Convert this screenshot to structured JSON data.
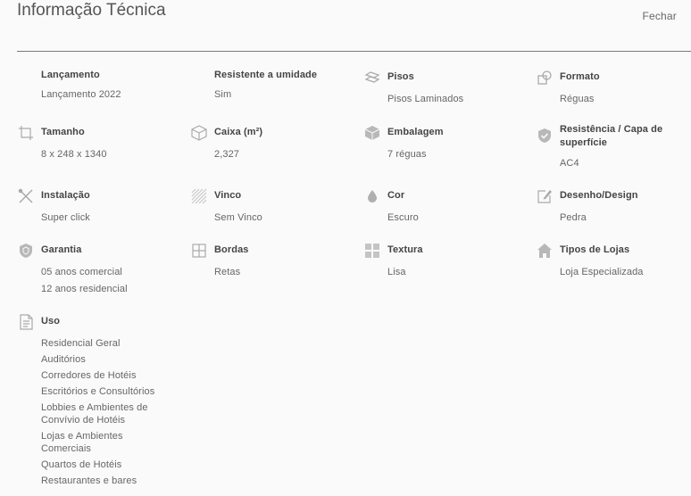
{
  "header": {
    "title": "Informação Técnica",
    "close_label": "Fechar"
  },
  "specs": {
    "lancamento": {
      "label": "Lançamento",
      "values": [
        "Lançamento 2022"
      ]
    },
    "umidade": {
      "label": "Resistente a umidade",
      "values": [
        "Sim"
      ]
    },
    "pisos": {
      "label": "Pisos",
      "icon": "floor-icon",
      "values": [
        "Pisos Laminados"
      ]
    },
    "formato": {
      "label": "Formato",
      "icon": "shapes-icon",
      "values": [
        "Réguas"
      ]
    },
    "tamanho": {
      "label": "Tamanho",
      "icon": "crop-icon",
      "values": [
        "8 x 248 x 1340"
      ]
    },
    "caixa": {
      "label": "Caixa (m²)",
      "icon": "box-icon",
      "values": [
        "2,327"
      ]
    },
    "embalagem": {
      "label": "Embalagem",
      "icon": "package-icon",
      "values": [
        "7 réguas"
      ]
    },
    "resistencia": {
      "label": "Resistência / Capa de superfície",
      "icon": "shield-check-icon",
      "values": [
        "AC4"
      ]
    },
    "instalacao": {
      "label": "Instalação",
      "icon": "tools-icon",
      "values": [
        "Super click"
      ]
    },
    "vinco": {
      "label": "Vinco",
      "icon": "hatch-icon",
      "values": [
        "Sem Vinco"
      ]
    },
    "cor": {
      "label": "Cor",
      "icon": "drop-icon",
      "values": [
        "Escuro"
      ]
    },
    "design": {
      "label": "Desenho/Design",
      "icon": "pencil-icon",
      "values": [
        "Pedra"
      ]
    },
    "garantia": {
      "label": "Garantia",
      "icon": "shield-icon",
      "values": [
        "05 anos comercial",
        "12 anos residencial"
      ]
    },
    "bordas": {
      "label": "Bordas",
      "icon": "grid-icon",
      "values": [
        "Retas"
      ]
    },
    "textura": {
      "label": "Textura",
      "icon": "texture-icon",
      "values": [
        "Lisa"
      ]
    },
    "lojas": {
      "label": "Tipos de Lojas",
      "icon": "store-icon",
      "values": [
        "Loja Especializada"
      ]
    },
    "uso": {
      "label": "Uso",
      "icon": "document-icon",
      "values": [
        "Residencial Geral",
        "Auditórios",
        "Corredores de Hotéis",
        "Escritórios e Consultórios",
        "Lobbies e Ambientes de Convívio de Hotéis",
        "Lojas e Ambientes Comerciais",
        "Quartos de Hotéis",
        "Restaurantes e bares"
      ]
    }
  }
}
